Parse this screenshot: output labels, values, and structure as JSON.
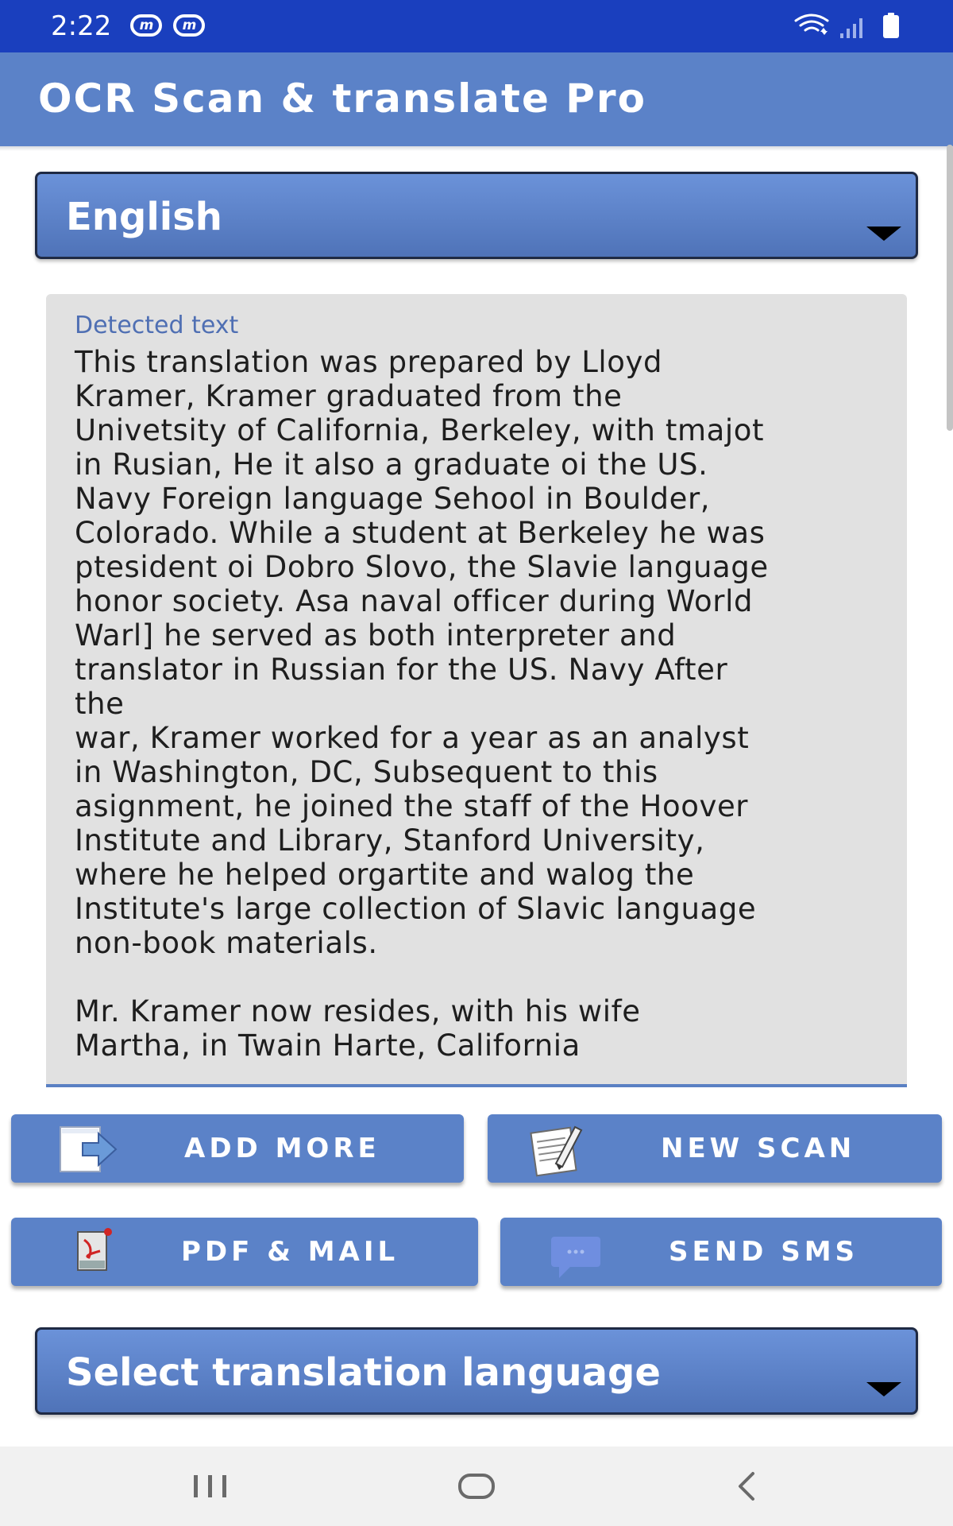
{
  "status_bar": {
    "time": "2:22",
    "notifications": [
      {
        "icon": "messenger-icon",
        "glyph": "m"
      },
      {
        "icon": "messenger-icon",
        "glyph": "m"
      }
    ],
    "system_icons": [
      "wifi-icon",
      "signal-icon",
      "battery-icon"
    ]
  },
  "app_bar": {
    "title": "OCR Scan & translate Pro"
  },
  "source_language": {
    "selected": "English"
  },
  "detected_text": {
    "label": "Detected text",
    "content": "This translation was prepared by Lloyd\nKramer, Kramer graduated from the\nUnivetsity of California, Berkeley, with tmajot\nin Rusian, He it also a graduate oi the US.\nNavy Foreign language Sehool in Boulder,\nColorado. While a student at Berkeley he was\nptesident oi Dobro Slovo, the Slavie language\nhonor society. Asa naval officer during World\nWarl] he served as both interpreter and\ntranslator in Russian for the US. Navy After\nthe\nwar, Kramer worked for a year as an analyst\nin Washington, DC, Subsequent to this\nasignment, he joined the staff of the Hoover\nInstitute and Library, Stanford University,\nwhere he helped orgartite and walog the\nInstitute's large collection of Slavic language\nnon-book materials.\n\nMr. Kramer now resides, with his wife\nMartha, in Twain Harte, California"
  },
  "actions": {
    "add_more": "ADD MORE",
    "new_scan": "NEW SCAN",
    "pdf_mail": "PDF & MAIL",
    "send_sms": "SEND SMS"
  },
  "target_language": {
    "placeholder": "Select translation language"
  },
  "nav_bar": {
    "items": [
      "recents-icon",
      "home-icon",
      "back-icon"
    ]
  },
  "colors": {
    "status_bar": "#1a3fbe",
    "primary": "#5b82c8",
    "spinner_top": "#6b92d9",
    "spinner_bottom": "#4f73b8",
    "text_box_bg": "#e1e1e1",
    "label_blue": "#4f6fb3"
  }
}
